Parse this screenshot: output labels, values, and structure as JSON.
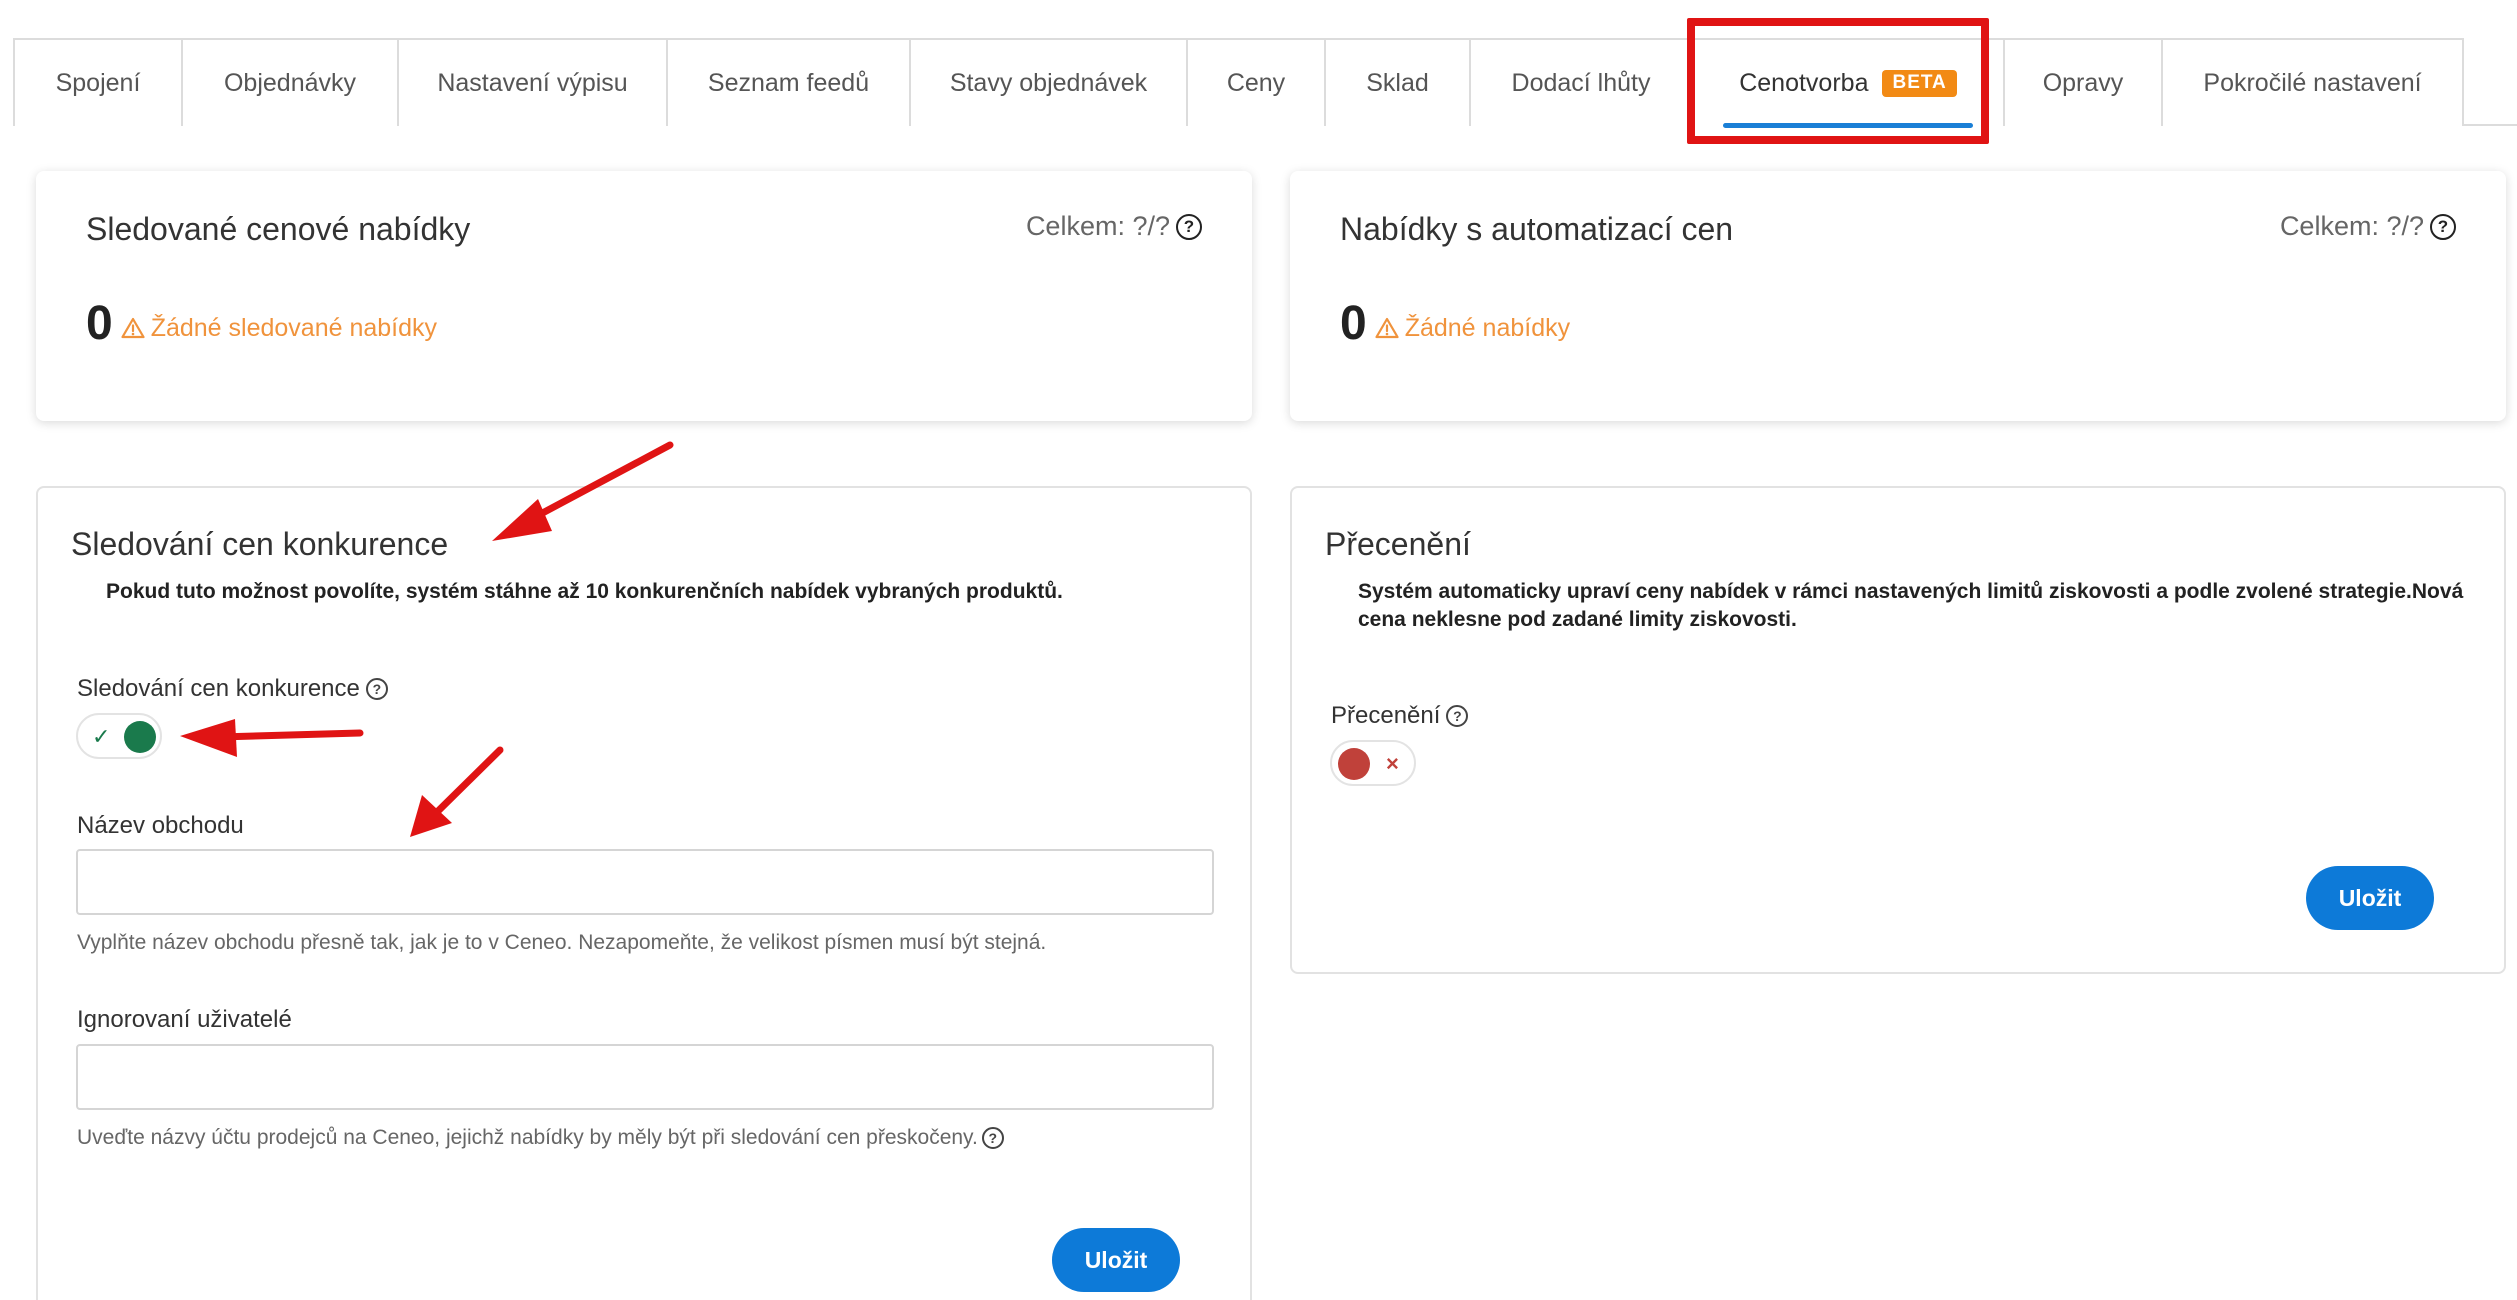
{
  "tabs": [
    {
      "label": "Spojení"
    },
    {
      "label": "Objednávky"
    },
    {
      "label": "Nastavení výpisu"
    },
    {
      "label": "Seznam feedů"
    },
    {
      "label": "Stavy objednávek"
    },
    {
      "label": "Ceny"
    },
    {
      "label": "Sklad"
    },
    {
      "label": "Dodací lhůty"
    },
    {
      "label": "Cenotvorba",
      "badge": "BETA",
      "active": true
    },
    {
      "label": "Opravy"
    },
    {
      "label": "Pokročilé nastavení"
    }
  ],
  "stats": {
    "tracked": {
      "title": "Sledované cenové nabídky",
      "total": "Celkem: ?/?",
      "value": "0",
      "warning": "Žádné sledované nabídky"
    },
    "automated": {
      "title": "Nabídky s automatizací cen",
      "total": "Celkem: ?/?",
      "value": "0",
      "warning": "Žádné nabídky"
    }
  },
  "competition": {
    "title": "Sledování cen konkurence",
    "description": "Pokud tuto možnost povolíte, systém stáhne až 10 konkurenčních nabídek vybraných produktů.",
    "toggle_label": "Sledování cen konkurence",
    "toggle_on": true,
    "shop_name_label": "Název obchodu",
    "shop_name_value": "",
    "shop_name_hint": "Vyplňte název obchodu přesně tak, jak je to v Ceneo. Nezapomeňte, že velikost písmen musí být stejná.",
    "ignored_label": "Ignorovaní uživatelé",
    "ignored_value": "",
    "ignored_hint": "Uveďte názvy účtu prodejců na Ceneo, jejichž nabídky by měly být při sledování cen přeskočeny.",
    "save_label": "Uložit"
  },
  "repricing": {
    "title": "Přecenění",
    "description": "Systém automaticky upraví ceny nabídek v rámci nastavených limitů ziskovosti a podle zvolené strategie.Nová cena neklesne pod zadané limity ziskovosti.",
    "toggle_label": "Přecenění",
    "toggle_on": false,
    "save_label": "Uložit"
  },
  "colors": {
    "accent": "#0d7ad8",
    "toggle_on": "#1a7a4c",
    "toggle_off": "#c0413a",
    "warning": "#f0933c",
    "badge": "#f28a14",
    "annotation": "#e01414"
  },
  "icons": {
    "help": "question-circle-icon",
    "warning": "warning-triangle-icon",
    "check": "check-icon",
    "close": "close-x-icon"
  }
}
